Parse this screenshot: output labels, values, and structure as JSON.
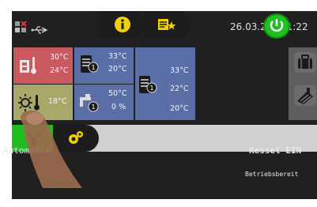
{
  "status_bar": {
    "date": "26.03.2019",
    "time": "11:22"
  },
  "tiles": {
    "heating": {
      "value_top": "30°C",
      "value_bottom": "24°C",
      "color": "#c9595f"
    },
    "boiler": {
      "value_top": "33°C",
      "value_bottom": "20°C",
      "color": "#5a6fa8"
    },
    "buffer": {
      "value_top": "33°C",
      "value_mid": "22°C",
      "value_bottom": "20°C",
      "color": "#5a6fa8"
    },
    "outdoor": {
      "value": "18°C",
      "color": "#a8a86a"
    },
    "pump": {
      "value_top": "50°C",
      "value_bottom": "0 %",
      "color": "#5a6fa8"
    }
  },
  "mode": {
    "label": "Automatik"
  },
  "boiler_status": {
    "title": "Kessel EIN",
    "subtitle": "Betriebsbereit"
  },
  "icons": [
    "error-icon",
    "usb-icon",
    "user-icon",
    "suitcase-icon",
    "chimney-icon",
    "heating-icon",
    "boiler-icon",
    "buffer-icon",
    "outdoor-sun-icon",
    "pump-icon",
    "automatic-mode-icon",
    "settings-icon",
    "info-icon",
    "menu-star-icon",
    "power-icon"
  ],
  "colors": {
    "accent_green": "#1fbe1f",
    "background": "#202020"
  }
}
